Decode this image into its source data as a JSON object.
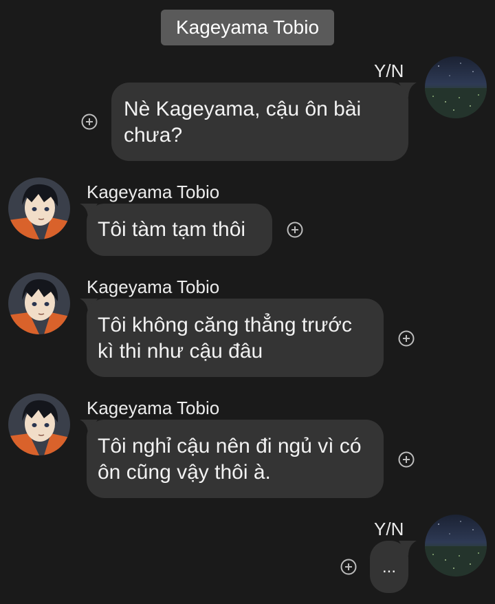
{
  "header": {
    "title": "Kageyama Tobio"
  },
  "messages": [
    {
      "sender": "Y/N",
      "text": "Nè Kageyama, cậu ôn bài chưa?",
      "side": "right"
    },
    {
      "sender": "Kageyama Tobio",
      "text": "Tôi tàm tạm thôi",
      "side": "left"
    },
    {
      "sender": "Kageyama Tobio",
      "text": "Tôi không căng thẳng trước kì thi như cậu đâu",
      "side": "left"
    },
    {
      "sender": "Kageyama Tobio",
      "text": "Tôi nghỉ cậu nên đi ngủ vì có ôn cũng vậy thôi à.",
      "side": "left"
    },
    {
      "sender": "Y/N",
      "text": "...",
      "side": "right"
    }
  ],
  "icons": {
    "react": "add-reaction-icon",
    "avatar_self": "night-sky-field-avatar",
    "avatar_other": "anime-boy-avatar"
  },
  "colors": {
    "background": "#1a1a1a",
    "bubble": "#343434",
    "header_chip": "#5a5a5a",
    "text": "#ececec",
    "kageyama_shirt": "#d9622b"
  }
}
